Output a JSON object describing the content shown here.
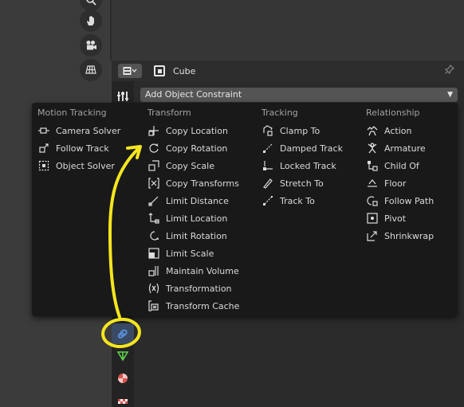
{
  "header": {
    "editor_type_icon": "properties-editor-icon",
    "object_name": "Cube",
    "pin_icon": "pin-icon"
  },
  "add_constraint": {
    "label": "Add Object Constraint"
  },
  "menu": {
    "motion_tracking": {
      "title": "Motion Tracking",
      "items": [
        {
          "label": "Camera Solver",
          "icon": "camera-solver-icon"
        },
        {
          "label": "Follow Track",
          "icon": "follow-track-icon"
        },
        {
          "label": "Object Solver",
          "icon": "object-solver-icon"
        }
      ]
    },
    "transform": {
      "title": "Transform",
      "items": [
        {
          "label": "Copy Location",
          "icon": "copy-location-icon"
        },
        {
          "label": "Copy Rotation",
          "icon": "copy-rotation-icon"
        },
        {
          "label": "Copy Scale",
          "icon": "copy-scale-icon"
        },
        {
          "label": "Copy Transforms",
          "icon": "copy-transforms-icon"
        },
        {
          "label": "Limit Distance",
          "icon": "limit-distance-icon"
        },
        {
          "label": "Limit Location",
          "icon": "limit-location-icon"
        },
        {
          "label": "Limit Rotation",
          "icon": "limit-rotation-icon"
        },
        {
          "label": "Limit Scale",
          "icon": "limit-scale-icon"
        },
        {
          "label": "Maintain Volume",
          "icon": "maintain-volume-icon"
        },
        {
          "label": "Transformation",
          "icon": "transformation-icon"
        },
        {
          "label": "Transform Cache",
          "icon": "transform-cache-icon"
        }
      ]
    },
    "tracking": {
      "title": "Tracking",
      "items": [
        {
          "label": "Clamp To",
          "icon": "clamp-to-icon"
        },
        {
          "label": "Damped Track",
          "icon": "damped-track-icon"
        },
        {
          "label": "Locked Track",
          "icon": "locked-track-icon"
        },
        {
          "label": "Stretch To",
          "icon": "stretch-to-icon"
        },
        {
          "label": "Track To",
          "icon": "track-to-icon"
        }
      ]
    },
    "relationship": {
      "title": "Relationship",
      "items": [
        {
          "label": "Action",
          "icon": "action-icon"
        },
        {
          "label": "Armature",
          "icon": "armature-icon"
        },
        {
          "label": "Child Of",
          "icon": "child-of-icon"
        },
        {
          "label": "Floor",
          "icon": "floor-icon"
        },
        {
          "label": "Follow Path",
          "icon": "follow-path-icon"
        },
        {
          "label": "Pivot",
          "icon": "pivot-icon"
        },
        {
          "label": "Shrinkwrap",
          "icon": "shrinkwrap-icon"
        }
      ]
    }
  },
  "colors": {
    "annotation": "#f5e51f",
    "menu_bg": "#191919",
    "constraint_tab_accent": "#5a8fd8",
    "data_tab_green": "#5fd14e",
    "material_tab_red": "#d9534f"
  }
}
